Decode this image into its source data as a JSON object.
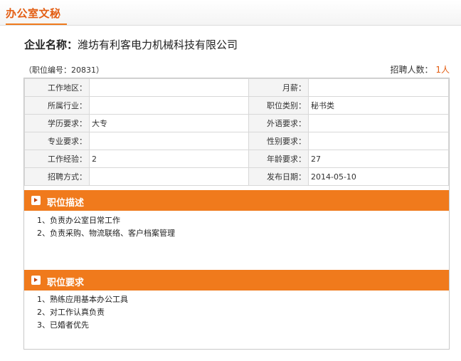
{
  "page": {
    "title": "办公室文秘"
  },
  "company": {
    "label": "企业名称：",
    "name": "潍坊有利客电力机械科技有限公司"
  },
  "job_meta": {
    "position_code": "（职位编号：20831）",
    "recruit_label": "招聘人数：",
    "recruit_count": "1人"
  },
  "info_rows": [
    {
      "k1": "工作地区：",
      "v1": "",
      "k2": "月薪：",
      "v2": ""
    },
    {
      "k1": "所属行业：",
      "v1": "",
      "k2": "职位类别：",
      "v2": "秘书类"
    },
    {
      "k1": "学历要求：",
      "v1": "大专",
      "k2": "外语要求：",
      "v2": ""
    },
    {
      "k1": "专业要求：",
      "v1": "",
      "k2": "性别要求：",
      "v2": ""
    },
    {
      "k1": "工作经验：",
      "v1": "2",
      "k2": "年龄要求：",
      "v2": "27"
    },
    {
      "k1": "招聘方式：",
      "v1": "",
      "k2": "发布日期：",
      "v2": "2014-05-10"
    }
  ],
  "description": {
    "title": "职位描述",
    "items": [
      "1、负责办公室日常工作",
      "2、负责采购、物流联络、客户档案管理"
    ]
  },
  "requirements": {
    "title": "职位要求",
    "items": [
      "1、熟练应用基本办公工具",
      "2、对工作认真负责",
      "3、已婚者优先"
    ]
  }
}
